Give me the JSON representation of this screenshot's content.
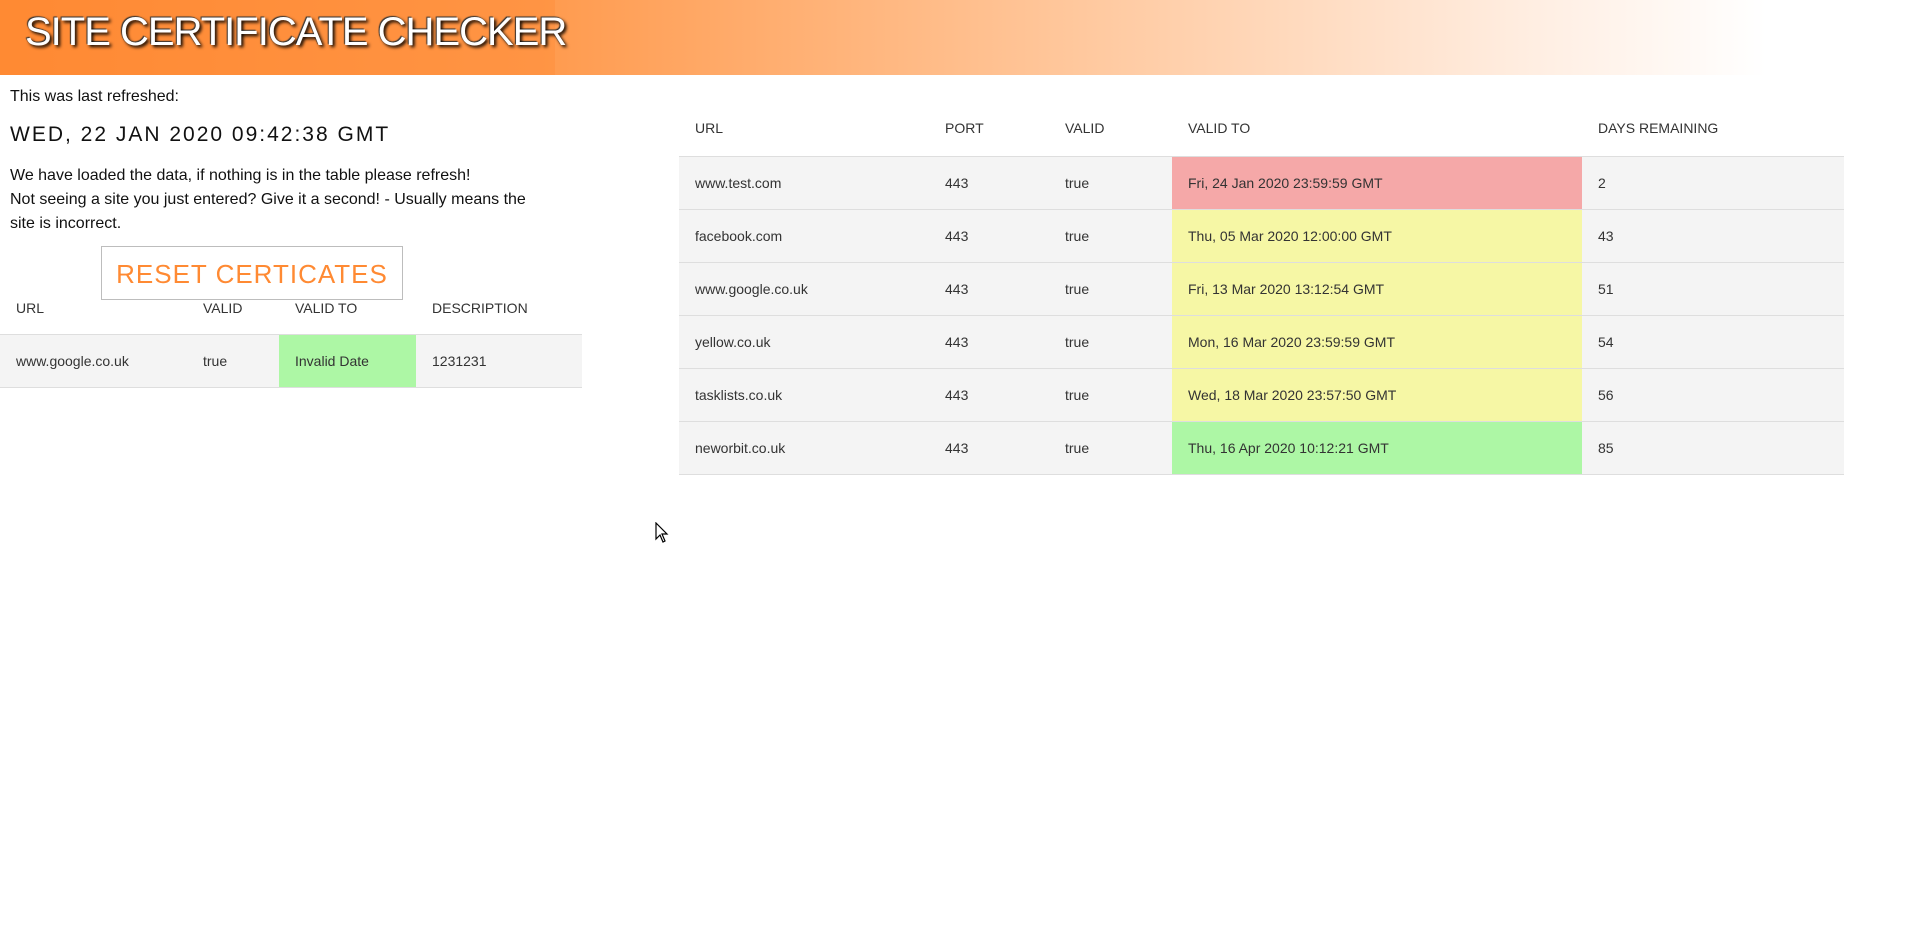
{
  "header": {
    "title": "SITE CERTIFICATE CHECKER"
  },
  "refresh": {
    "label": "This was last refreshed:",
    "timestamp": "WED, 22 JAN 2020 09:42:38 GMT"
  },
  "info": {
    "line1": "We have loaded the data, if nothing is in the table please refresh!",
    "line2": "Not seeing a site you just entered? Give it a second! - Usually means the site is incorrect."
  },
  "reset_button": {
    "label": "RESET CERTICATES"
  },
  "left_table": {
    "columns": [
      "URL",
      "VALID",
      "VALID TO",
      "DESCRIPTION"
    ],
    "rows": [
      {
        "url": "www.google.co.uk",
        "valid": "true",
        "valid_to": "Invalid Date",
        "valid_to_color": "#adf7a5",
        "description": "1231231"
      }
    ]
  },
  "right_table": {
    "columns": [
      "URL",
      "PORT",
      "VALID",
      "VALID TO",
      "DAYS REMAINING"
    ],
    "rows": [
      {
        "url": "www.test.com",
        "port": "443",
        "valid": "true",
        "valid_to": "Fri, 24 Jan 2020 23:59:59 GMT",
        "valid_to_color": "#f5a8a8",
        "days_remaining": "2"
      },
      {
        "url": "facebook.com",
        "port": "443",
        "valid": "true",
        "valid_to": "Thu, 05 Mar 2020 12:00:00 GMT",
        "valid_to_color": "#f6f7a5",
        "days_remaining": "43"
      },
      {
        "url": "www.google.co.uk",
        "port": "443",
        "valid": "true",
        "valid_to": "Fri, 13 Mar 2020 13:12:54 GMT",
        "valid_to_color": "#f6f7a5",
        "days_remaining": "51"
      },
      {
        "url": "yellow.co.uk",
        "port": "443",
        "valid": "true",
        "valid_to": "Mon, 16 Mar 2020 23:59:59 GMT",
        "valid_to_color": "#f6f7a5",
        "days_remaining": "54"
      },
      {
        "url": "tasklists.co.uk",
        "port": "443",
        "valid": "true",
        "valid_to": "Wed, 18 Mar 2020 23:57:50 GMT",
        "valid_to_color": "#f6f7a5",
        "days_remaining": "56"
      },
      {
        "url": "neworbit.co.uk",
        "port": "443",
        "valid": "true",
        "valid_to": "Thu, 16 Apr 2020 10:12:21 GMT",
        "valid_to_color": "#adf7a5",
        "days_remaining": "85"
      }
    ]
  },
  "colors": {
    "accent": "#ff8a33",
    "expiring_soon": "#f5a8a8",
    "warning": "#f6f7a5",
    "ok": "#adf7a5"
  }
}
